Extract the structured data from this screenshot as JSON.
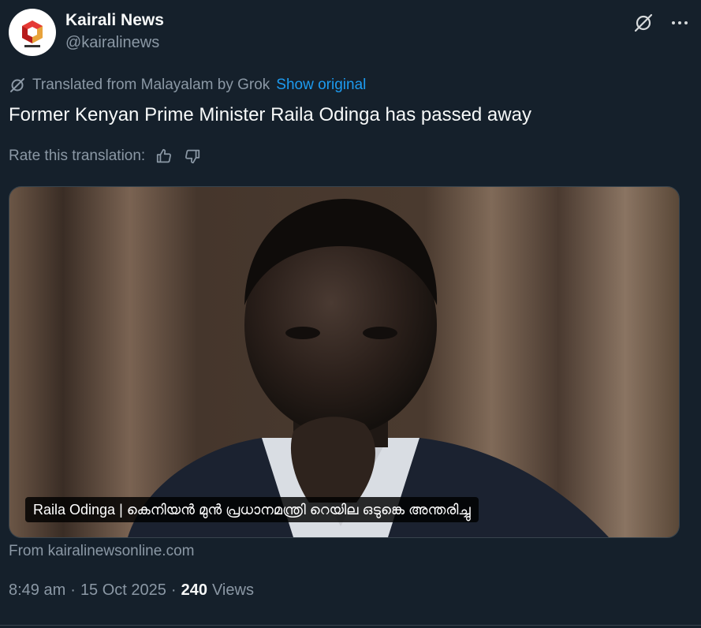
{
  "author": {
    "display_name": "Kairali News",
    "handle": "@kairalinews"
  },
  "translation": {
    "notice": "Translated from Malayalam by Grok",
    "show_original": "Show original",
    "rate_label": "Rate this translation:"
  },
  "tweet": {
    "text": "Former Kenyan Prime Minister Raila Odinga has passed away"
  },
  "card": {
    "caption": "Raila Odinga | കെനിയൻ മുൻ പ്രധാനമന്ത്രി റെയില ഒടുങ്കെ അന്തരിച്ചു",
    "source": "From kairalinewsonline.com"
  },
  "meta": {
    "time": "8:49 am",
    "sep1": "·",
    "date": "15 Oct 2025",
    "sep2": "·",
    "views_count": "240",
    "views_label": "Views"
  },
  "colors": {
    "background": "#15202b",
    "accent": "#1d9bf0",
    "secondary_text": "#8b98a5"
  }
}
